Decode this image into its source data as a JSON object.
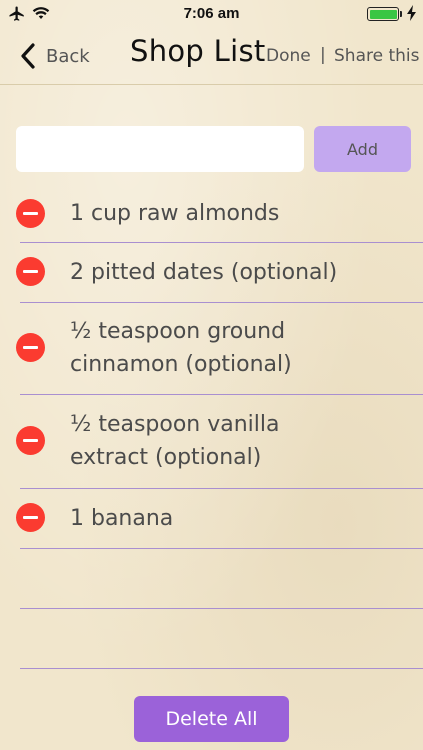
{
  "status_bar": {
    "time": "7:06 am",
    "airplane_icon": "airplane-icon",
    "wifi_icon": "wifi-icon",
    "battery_icon": "battery-icon",
    "charging_icon": "charging-bolt-icon",
    "battery_color": "#39c643"
  },
  "nav": {
    "back_label": "Back",
    "title": "Shop List",
    "done_label": "Done",
    "separator": "|",
    "share_label": "Share this"
  },
  "input": {
    "value": "",
    "placeholder": "",
    "add_label": "Add"
  },
  "items": [
    {
      "lines": [
        "1 cup raw almonds"
      ]
    },
    {
      "lines": [
        "2 pitted dates (optional)"
      ]
    },
    {
      "lines": [
        "½ teaspoon ground",
        "cinnamon (optional)"
      ]
    },
    {
      "lines": [
        "½ teaspoon vanilla",
        "extract (optional)"
      ]
    },
    {
      "lines": [
        "1 banana"
      ]
    }
  ],
  "footer": {
    "delete_all_label": "Delete All"
  },
  "colors": {
    "background": "#f1e6cc",
    "add_button": "#c3a8ef",
    "delete_all_button": "#9b62d9",
    "delete_icon": "#fb3b30",
    "rule_line": "#a98fd0"
  }
}
